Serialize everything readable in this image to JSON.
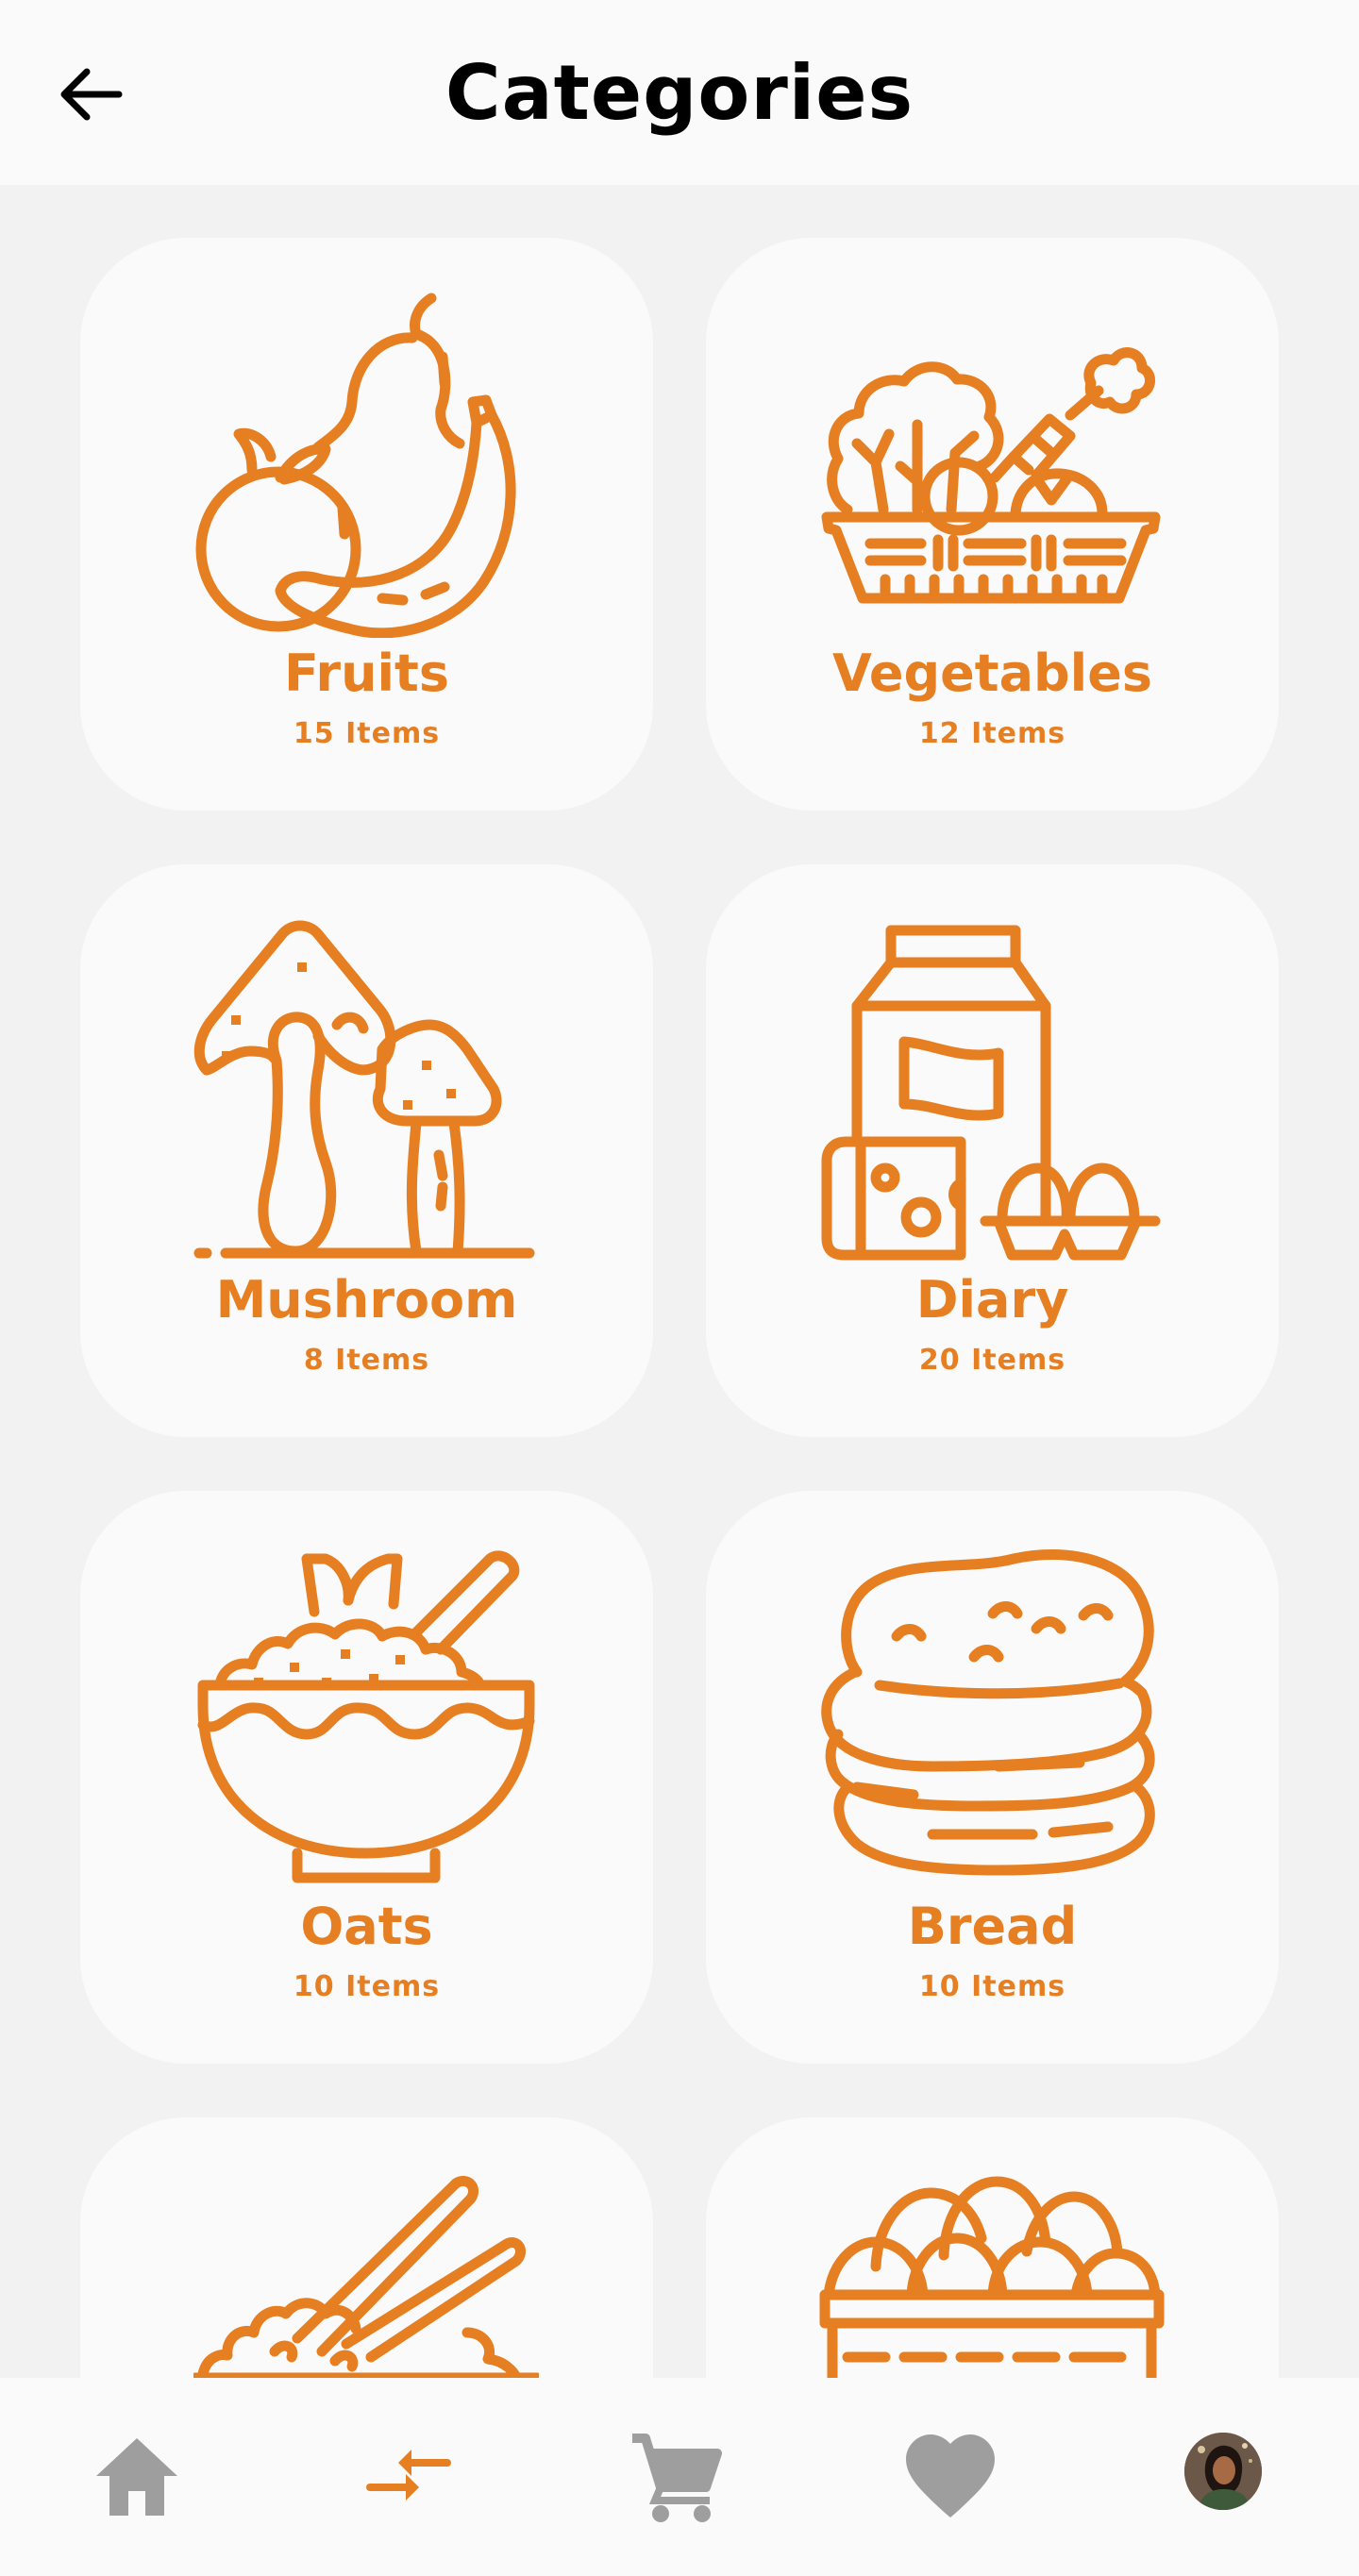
{
  "header": {
    "title": "Categories",
    "back_icon": "arrow-left-icon"
  },
  "colors": {
    "accent": "#e67e22",
    "nav_inactive": "#9e9e9e",
    "background": "#f2f2f2",
    "card": "#fafafa"
  },
  "categories": [
    {
      "name": "Fruits",
      "count": "15 Items",
      "icon": "fruits-icon"
    },
    {
      "name": "Vegetables",
      "count": "12 Items",
      "icon": "vegetables-icon"
    },
    {
      "name": "Mushroom",
      "count": "8 Items",
      "icon": "mushroom-icon"
    },
    {
      "name": "Diary",
      "count": "20 Items",
      "icon": "dairy-icon"
    },
    {
      "name": "Oats",
      "count": "10 Items",
      "icon": "oats-icon"
    },
    {
      "name": "Bread",
      "count": "10 Items",
      "icon": "bread-icon"
    },
    {
      "name": "",
      "count": "",
      "icon": "noodles-icon"
    },
    {
      "name": "",
      "count": "",
      "icon": "eggs-icon"
    }
  ],
  "bottom_nav": [
    {
      "icon": "home-icon",
      "active": false
    },
    {
      "icon": "exchange-icon",
      "active": true
    },
    {
      "icon": "cart-icon",
      "active": false
    },
    {
      "icon": "heart-icon",
      "active": false
    },
    {
      "icon": "profile-avatar",
      "active": false
    }
  ]
}
